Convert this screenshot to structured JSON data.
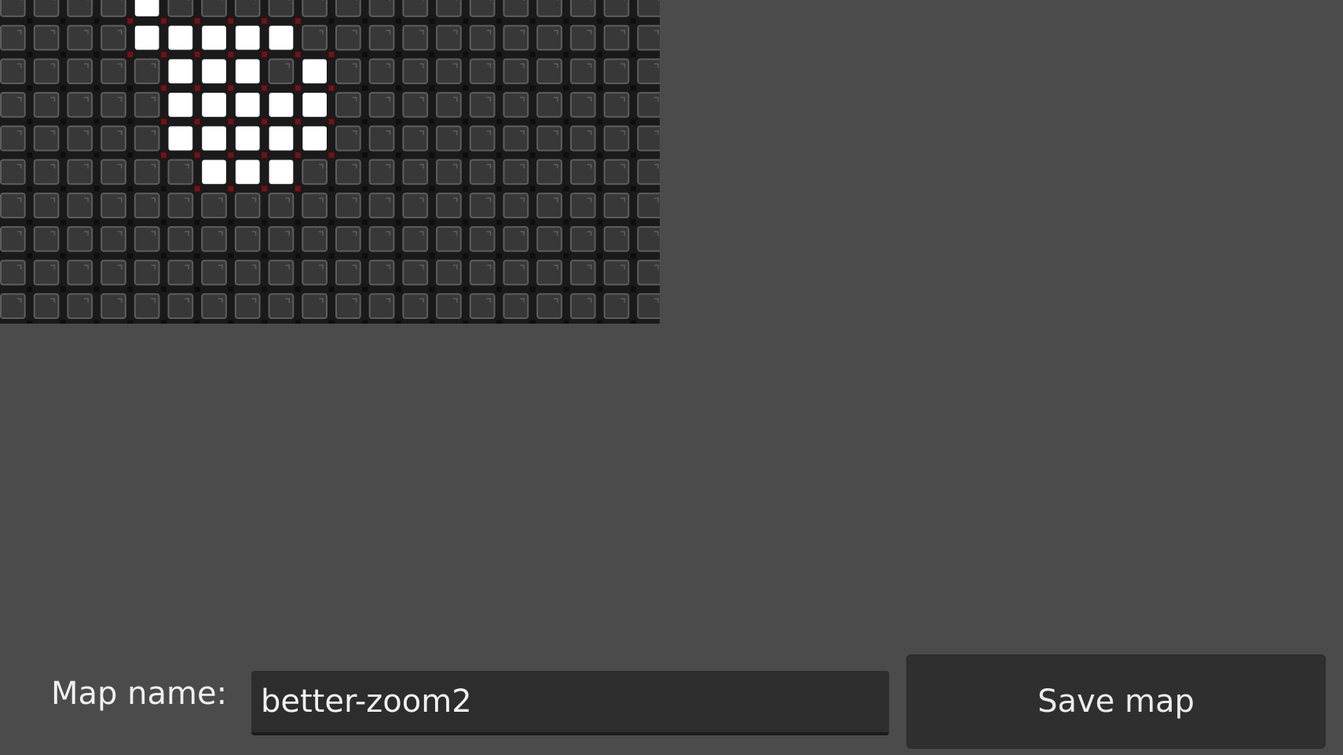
{
  "map": {
    "cols": 20,
    "rows": 10,
    "filled": [
      [
        0,
        4
      ],
      [
        1,
        4
      ],
      [
        1,
        5
      ],
      [
        1,
        6
      ],
      [
        1,
        7
      ],
      [
        1,
        8
      ],
      [
        2,
        5
      ],
      [
        2,
        6
      ],
      [
        2,
        7
      ],
      [
        2,
        9
      ],
      [
        3,
        5
      ],
      [
        3,
        6
      ],
      [
        3,
        7
      ],
      [
        3,
        8
      ],
      [
        3,
        9
      ],
      [
        4,
        5
      ],
      [
        4,
        6
      ],
      [
        4,
        7
      ],
      [
        4,
        8
      ],
      [
        4,
        9
      ],
      [
        5,
        6
      ],
      [
        5,
        7
      ],
      [
        5,
        8
      ]
    ],
    "colors": {
      "background": "#4b4b4b",
      "grid_line": "#1a1a1a",
      "tile": "#383838",
      "tile_border": "#5e5e5e",
      "filled_tile": "#ffffff",
      "edge_marker": "#7a1010",
      "vertex": "#0e0e0e"
    }
  },
  "form": {
    "label": "Map name:",
    "input_value": "better-zoom2",
    "save_label": "Save map"
  }
}
